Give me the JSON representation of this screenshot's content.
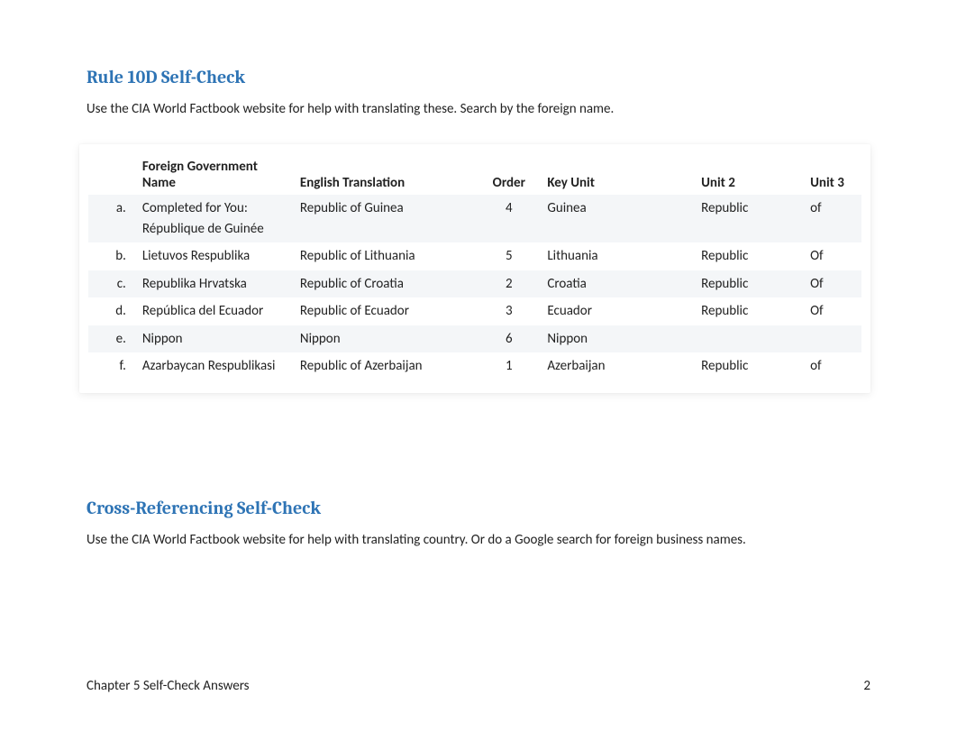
{
  "section1": {
    "title": "Rule 10D Self-Check",
    "intro": "Use the CIA World Factbook website for help with translating these. Search by the foreign name."
  },
  "table": {
    "headers": {
      "foreign": "Foreign Government Name",
      "english": "English Translation",
      "order": "Order",
      "key": "Key Unit",
      "unit2": "Unit 2",
      "unit3": "Unit 3"
    },
    "rows": [
      {
        "label": "a.",
        "foreign": "Completed for You: République de Guinée",
        "english": "Republic of Guinea",
        "order": "4",
        "key": "Guinea",
        "unit2": "Republic",
        "unit3": "of"
      },
      {
        "label": "b.",
        "foreign": "Lietuvos Respublika",
        "english": "Republic of Lithuania",
        "order": "5",
        "key": "Lithuania",
        "unit2": "Republic",
        "unit3": "Of"
      },
      {
        "label": "c.",
        "foreign": "Republika Hrvatska",
        "english": "Republic of Croatia",
        "order": "2",
        "key": "Croatia",
        "unit2": "Republic",
        "unit3": "Of"
      },
      {
        "label": "d.",
        "foreign": "República del Ecuador",
        "english": "Republic of Ecuador",
        "order": "3",
        "key": "Ecuador",
        "unit2": "Republic",
        "unit3": "Of"
      },
      {
        "label": "e.",
        "foreign": "Nippon",
        "english": "Nippon",
        "order": "6",
        "key": "Nippon",
        "unit2": "",
        "unit3": ""
      },
      {
        "label": "f.",
        "foreign": "Azarbaycan Respublikasi",
        "english": "Republic of Azerbaijan",
        "order": "1",
        "key": "Azerbaijan",
        "unit2": "Republic",
        "unit3": "of"
      }
    ]
  },
  "section2": {
    "title": "Cross-Referencing Self-Check",
    "intro": "Use the CIA World Factbook website for help with translating country.  Or do a Google search for foreign business names."
  },
  "footer": {
    "left": "Chapter 5 Self-Check Answers",
    "right": "2"
  },
  "chart_data": {
    "type": "table",
    "title": "Rule 10D Self-Check",
    "columns": [
      "",
      "Foreign Government Name",
      "English Translation",
      "Order",
      "Key Unit",
      "Unit 2",
      "Unit 3"
    ],
    "rows": [
      [
        "a.",
        "Completed for You: République de Guinée",
        "Republic of Guinea",
        4,
        "Guinea",
        "Republic",
        "of"
      ],
      [
        "b.",
        "Lietuvos Respublika",
        "Republic of Lithuania",
        5,
        "Lithuania",
        "Republic",
        "Of"
      ],
      [
        "c.",
        "Republika Hrvatska",
        "Republic of Croatia",
        2,
        "Croatia",
        "Republic",
        "Of"
      ],
      [
        "d.",
        "República del Ecuador",
        "Republic of Ecuador",
        3,
        "Ecuador",
        "Republic",
        "Of"
      ],
      [
        "e.",
        "Nippon",
        "Nippon",
        6,
        "Nippon",
        "",
        ""
      ],
      [
        "f.",
        "Azarbaycan Respublikasi",
        "Republic of Azerbaijan",
        1,
        "Azerbaijan",
        "Republic",
        "of"
      ]
    ]
  }
}
